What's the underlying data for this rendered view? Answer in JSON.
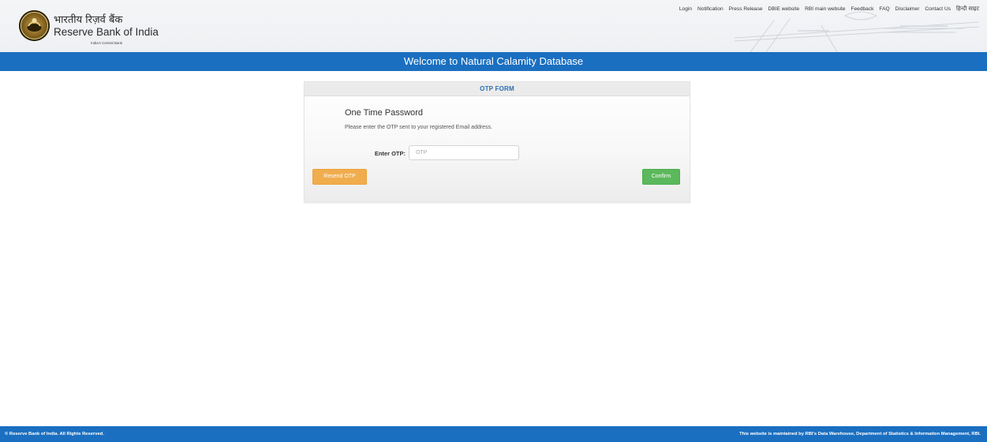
{
  "header": {
    "logo_hindi": "भारतीय रिज़र्व बैंक",
    "logo_english": "Reserve Bank of India",
    "logo_tagline": "India's Central Bank",
    "nav": [
      {
        "label": "Login"
      },
      {
        "label": "Notification"
      },
      {
        "label": "Press Release"
      },
      {
        "label": "DBIE website"
      },
      {
        "label": "RBI main website"
      },
      {
        "label": "Feedback"
      },
      {
        "label": "FAQ"
      },
      {
        "label": "Disclaimer"
      },
      {
        "label": "Contact Us"
      },
      {
        "label": "हिन्दी साइट"
      }
    ]
  },
  "title_bar": {
    "text": "Welcome to Natural Calamity Database"
  },
  "otp_form": {
    "header": "OTP FORM",
    "title": "One Time Password",
    "description": "Please enter the OTP sent to your registered Email address.",
    "label": "Enter OTP:",
    "input_value": "",
    "input_placeholder": "OTP",
    "resend_label": "Resend OTP",
    "confirm_label": "Confirm"
  },
  "footer": {
    "left": "© Reserve Bank of India. All Rights Reserved.",
    "right": "This website is maintained by RBI's Data Warehouse, Department of Statistics & Information Management, RBI."
  },
  "colors": {
    "brand_blue": "#1b6fc0",
    "panel_header_text": "#2a6eb5",
    "resend_button": "#f0ad4e",
    "confirm_button": "#5cb85c"
  },
  "icons": {
    "logo": "rbi-seal-icon"
  }
}
